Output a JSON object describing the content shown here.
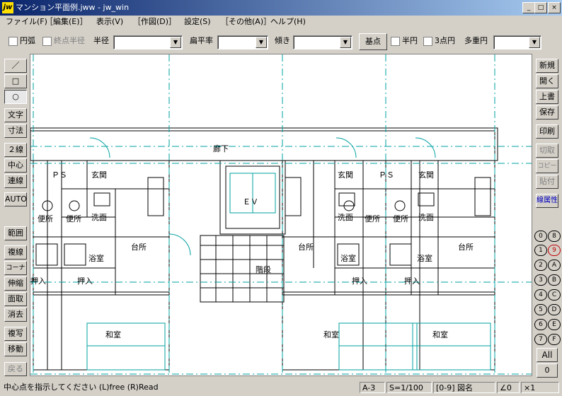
{
  "window": {
    "app_icon": "jw",
    "title": "マンション平面例.jww - jw_win",
    "min": "_",
    "max": "□",
    "close": "×"
  },
  "menu": [
    "ファイル(F)",
    "［編集(E)］",
    "表示(V)",
    "［作図(D)］",
    "設定(S)",
    "［その他(A)］",
    "ヘルプ(H)"
  ],
  "toolbar": {
    "arc": "円弧",
    "endpoint_radius": "終点半径",
    "radius": "半径",
    "flatness": "扁平率",
    "tilt": "傾き",
    "base_point": "基点",
    "semicircle": "半円",
    "three_point": "3点円",
    "multi_circle": "多重円"
  },
  "left_tools": [
    "／",
    "□",
    "○",
    "文字",
    "寸法",
    "２線",
    "中心線",
    "連線",
    "AUTO",
    "範囲",
    "複線",
    "コーナー",
    "伸縮",
    "面取",
    "消去",
    "複写",
    "移動",
    "戻る"
  ],
  "right_tools": [
    "新規",
    "開く",
    "上書",
    "保存",
    "印刷",
    "切取",
    "コピー",
    "貼付",
    "線属性"
  ],
  "layers": [
    [
      "0",
      "8"
    ],
    [
      "1",
      "9"
    ],
    [
      "2",
      "A"
    ],
    [
      "3",
      "B"
    ],
    [
      "4",
      "C"
    ],
    [
      "5",
      "D"
    ],
    [
      "6",
      "E"
    ],
    [
      "7",
      "F"
    ]
  ],
  "layer_all": "All",
  "layer_zero": "0",
  "drawing": {
    "corridor": "廊下",
    "ev": "ＥＶ",
    "stairs": "階段",
    "ps": "ＰＳ",
    "entrance": "玄関",
    "toilet": "便所",
    "washroom": "洗面",
    "kitchen": "台所",
    "bath": "浴室",
    "closet": "押入",
    "japanese_room": "和室"
  },
  "status": {
    "message": "中心点を指示してください (L)free (R)Read",
    "code": "A-3",
    "scale": "S=1/100",
    "layer": "[0-9] 図名",
    "angle": "∠0",
    "mult": "×1"
  }
}
